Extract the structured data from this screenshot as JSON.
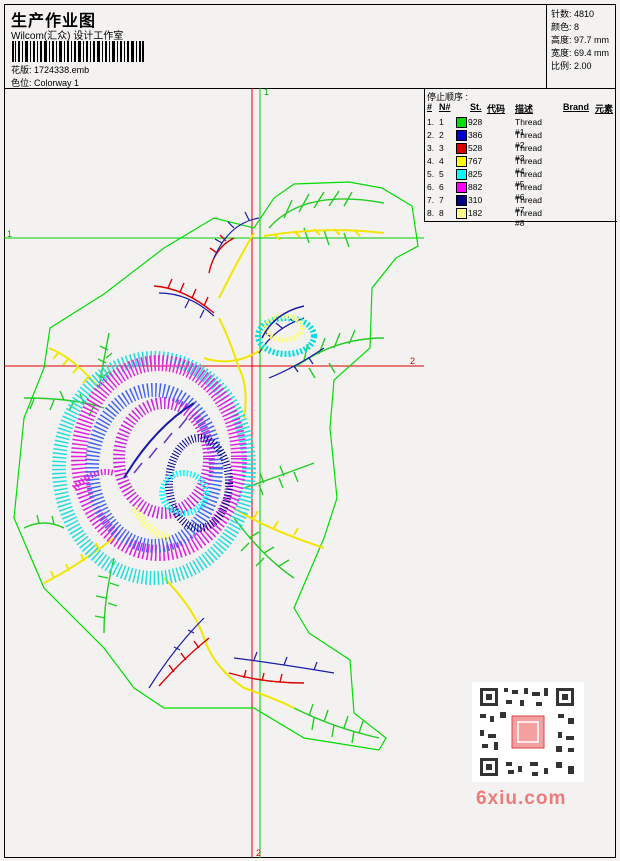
{
  "header": {
    "title": "生产作业图",
    "company": "Wilcom(汇众) 设计工作室",
    "design_label": "花版:",
    "design_value": "1724338.emb",
    "colorway_label": "色位:",
    "colorway_value": "Colorway 1"
  },
  "stats": {
    "stitches": "针数: 4810",
    "colors": "颜色: 8",
    "height": "高度: 97.7 mm",
    "width": "宽度: 69.4 mm",
    "scale": "比例: 2.00"
  },
  "sequence": {
    "title": "停止顺序 :",
    "headers": {
      "num": "#",
      "n": "N#",
      "st": "St.",
      "code": "代码",
      "desc": "描述",
      "brand": "Brand",
      "element": "元素"
    },
    "rows": [
      {
        "idx": "1.",
        "n": "1",
        "code": "928",
        "desc": "Thread #1",
        "color": "#00dd00"
      },
      {
        "idx": "2.",
        "n": "2",
        "code": "386",
        "desc": "Thread #2",
        "color": "#0000cc"
      },
      {
        "idx": "3.",
        "n": "3",
        "code": "528",
        "desc": "Thread #3",
        "color": "#dd0000"
      },
      {
        "idx": "4.",
        "n": "4",
        "code": "767",
        "desc": "Thread #4",
        "color": "#ffff00"
      },
      {
        "idx": "5.",
        "n": "5",
        "code": "825",
        "desc": "Thread #5",
        "color": "#00ffff"
      },
      {
        "idx": "6.",
        "n": "6",
        "code": "882",
        "desc": "Thread #6",
        "color": "#ff00ff"
      },
      {
        "idx": "7.",
        "n": "7",
        "code": "310",
        "desc": "Thread #7",
        "color": "#000088"
      },
      {
        "idx": "8.",
        "n": "8",
        "code": "182",
        "desc": "Thread #8",
        "color": "#ffff88"
      }
    ]
  },
  "guides": {
    "v_top": "1",
    "v_bottom": "2",
    "h_left": "1",
    "h_right": "2"
  },
  "watermark": "6xiu.com",
  "colors": {
    "green_guide": "#00cc00",
    "red_guide": "#dd0000",
    "outline": "#00dd00"
  }
}
